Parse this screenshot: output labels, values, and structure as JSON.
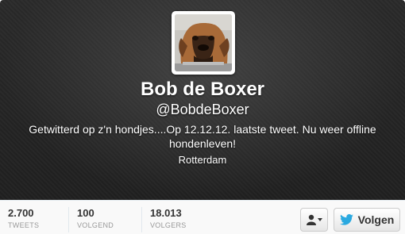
{
  "profile": {
    "name": "Bob de Boxer",
    "handle": "@BobdeBoxer",
    "bio": "Getwitterd op z'n hondjes....Op 12.12.12. laatste tweet. Nu weer offline hondenleven!",
    "location": "Rotterdam"
  },
  "stats": [
    {
      "value": "2.700",
      "label": "TWEETS"
    },
    {
      "value": "100",
      "label": "VOLGEND"
    },
    {
      "value": "18.013",
      "label": "VOLGERS"
    }
  ],
  "actions": {
    "user_menu_icon": "person-dropdown-icon",
    "follow_label": "Volgen",
    "follow_icon": "twitter-bird-icon"
  },
  "colors": {
    "header_bg": "#222222",
    "twitter_blue": "#2aa9e0"
  }
}
